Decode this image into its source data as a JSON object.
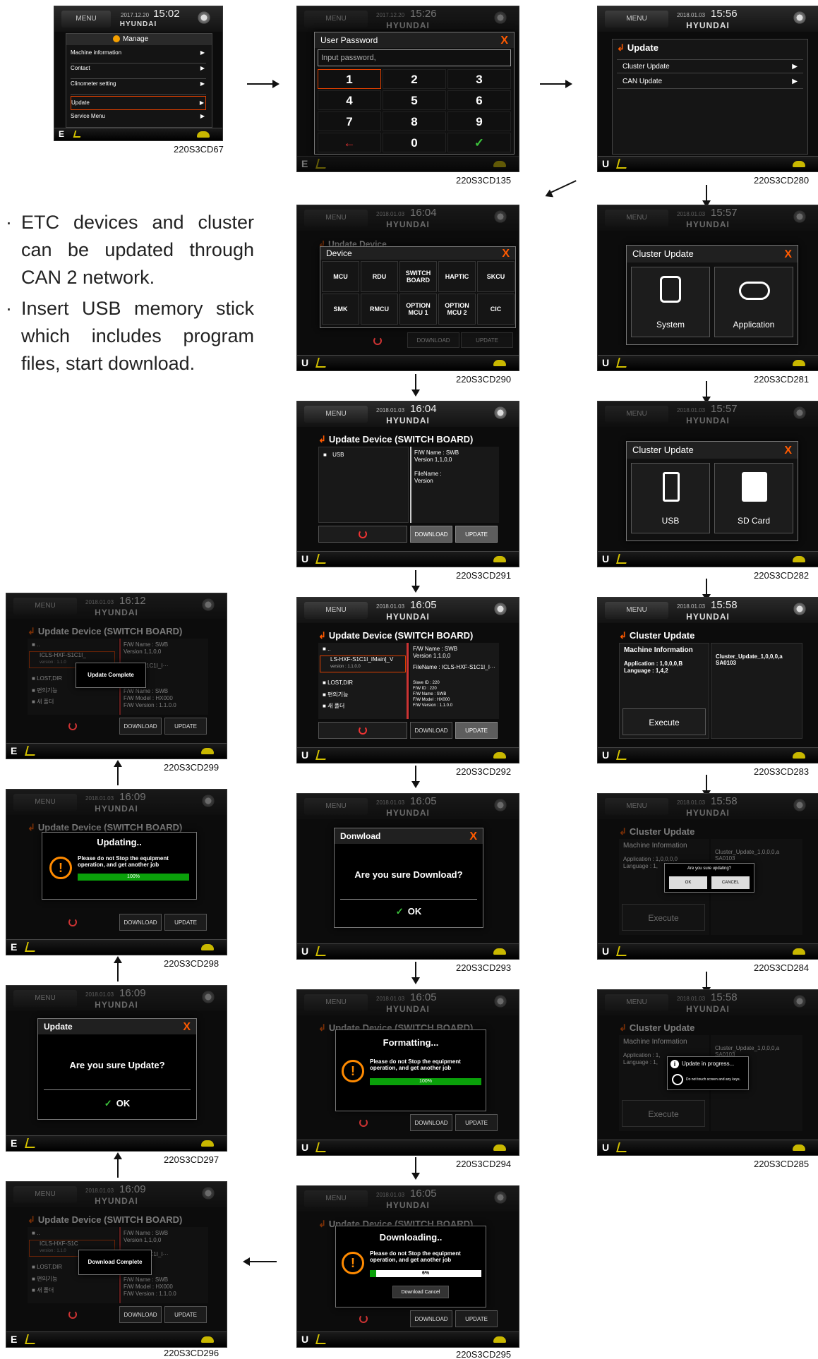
{
  "notes": [
    "ETC devices and cluster can be updated through CAN 2 network.",
    "Insert USB memory stick which includes program files, start download."
  ],
  "bullet": "·",
  "common": {
    "menu": "MENU",
    "brand": "HYUNDAI",
    "download": "DOWNLOAD",
    "update": "UPDATE",
    "execute": "Execute",
    "ok": "OK",
    "please_wait": "Please do not Stop the equipment operation, and get another job",
    "fw_name": "F/W Name : SWB",
    "fw_version": "Version 1,1,0,0",
    "usb": "USB",
    "up": "..",
    "lost_dir": "LOST,DIR",
    "korean_1": "편의기능",
    "korean_2": "새 폴더",
    "update_device_sb": "Update Device (SWITCH BOARD)",
    "cluster_update": "Cluster Update",
    "machine_information": "Machine Information",
    "cluster_file": "Cluster_Update_1,0,0,0,a SA0103"
  },
  "panels": {
    "cd67": {
      "code": "220S3CD67",
      "date": "2017.12.20",
      "time": "15:02",
      "manage": "Manage",
      "items": [
        "Machine information",
        "Contact",
        "Clinometer setting",
        "Update",
        "Service Menu"
      ],
      "mode": "E"
    },
    "cd135": {
      "code": "220S3CD135",
      "date": "2017.12.20",
      "time": "15:26",
      "title": "User Password",
      "placeholder": "Input password,",
      "keys": [
        "1",
        "2",
        "3",
        "4",
        "5",
        "6",
        "7",
        "8",
        "9",
        "←",
        "0",
        "✓"
      ],
      "mode": "E"
    },
    "cd280": {
      "code": "220S3CD280",
      "date": "2018.01.03",
      "time": "15:56",
      "title": "Update",
      "items": [
        "Cluster Update",
        "CAN Update"
      ],
      "mode": "U"
    },
    "cd290": {
      "code": "220S3CD290",
      "date": "2018.01.03",
      "time": "16:04",
      "bg_title": "Update Device",
      "title": "Device",
      "devices": [
        "MCU",
        "RDU",
        "SWITCH BOARD",
        "HAPTIC",
        "SKCU",
        "SMK",
        "RMCU",
        "OPTION MCU 1",
        "OPTION MCU 2",
        "CIC"
      ],
      "mode": "U"
    },
    "cd281": {
      "code": "220S3CD281",
      "date": "2018.01.03",
      "time": "15:57",
      "title": "Cluster Update",
      "opt1": "System",
      "opt2": "Application",
      "mode": "U"
    },
    "cd291": {
      "code": "220S3CD291",
      "date": "2018.01.03",
      "time": "16:04",
      "file_name": "FileName :",
      "version": "Version",
      "mode": "U"
    },
    "cd282": {
      "code": "220S3CD282",
      "date": "2018.01.03",
      "time": "15:57",
      "title": "Cluster Update",
      "opt1": "USB",
      "opt2": "SD Card",
      "mode": "U"
    },
    "cd299": {
      "code": "220S3CD299",
      "date": "2018.01.03",
      "time": "16:12",
      "message": "Update Complete",
      "file": "ICLS-HXF-S1C1I_",
      "file_ver": "version : 1.1.0",
      "right_name": "S-HXF-S1C1I_I···",
      "fw_model": "F/W Model : HX000",
      "fw_ver2": "F/W Version : 1.1.0.0",
      "mode": "E"
    },
    "cd292": {
      "code": "220S3CD292",
      "date": "2018.01.03",
      "time": "16:05",
      "file": "LS-HXF-S1C1I_IMain]_V",
      "file_ver": "version : 1.1.0.0",
      "file_name": "FileName : ICLS-HXF-S1C1I_I···",
      "details": [
        "Slave ID : 220",
        "F/W ID : 220",
        "F/W Name : SWB",
        "F/W Model : HX000",
        "F/W Version : 1.1.0.0"
      ],
      "mode": "U"
    },
    "cd283": {
      "code": "220S3CD283",
      "date": "2018.01.03",
      "time": "15:58",
      "app_line": "Application : 1,0,0,0,B",
      "lang_line": "Language : 1,4,2",
      "mode": "U"
    },
    "cd298": {
      "code": "220S3CD298",
      "date": "2018.01.03",
      "time": "16:09",
      "title": "Updating..",
      "pct": "100%",
      "progress": 1.0,
      "mode": "E"
    },
    "cd293": {
      "code": "220S3CD293",
      "date": "2018.01.03",
      "time": "16:05",
      "title": "Donwload",
      "question": "Are you sure Download?",
      "mode": "U"
    },
    "cd284": {
      "code": "220S3CD284",
      "date": "2018.01.03",
      "time": "15:58",
      "question": "Are you sure updating?",
      "ok": "OK",
      "cancel": "CANCEL",
      "app_line": "Application : 1,0,0,0,0",
      "lang_line": "Language : 1,",
      "mode": "U"
    },
    "cd297": {
      "code": "220S3CD297",
      "date": "2018.01.03",
      "time": "16:09",
      "title": "Update",
      "question": "Are you sure Update?",
      "mode": "E"
    },
    "cd294": {
      "code": "220S3CD294",
      "date": "2018.01.03",
      "time": "16:05",
      "title": "Formatting...",
      "pct": "100%",
      "progress": 1.0,
      "mode": "U"
    },
    "cd285": {
      "code": "220S3CD285",
      "date": "2018.01.03",
      "time": "15:58",
      "title": "Update in progress...",
      "sub": "Do not touch screen and any keys.",
      "app_line": "Application : 1,",
      "lang_line": "Language : 1,",
      "mode": "U"
    },
    "cd296": {
      "code": "220S3CD296",
      "date": "2018.01.03",
      "time": "16:09",
      "message": "Download Complete",
      "file": "ICLS-HXF-S1C",
      "file_ver": "version : 1.1.0",
      "right_name": "S-HXF-S1C1I_I···",
      "fw_model": "F/W Model : HX000",
      "fw_ver2": "F/W Version : 1.1.0.0",
      "mode": "E"
    },
    "cd295": {
      "code": "220S3CD295",
      "date": "2018.01.03",
      "time": "16:05",
      "title": "Downloading..",
      "pct": "6%",
      "progress": 0.06,
      "cancel": "Download Cancel",
      "mode": "U"
    }
  }
}
